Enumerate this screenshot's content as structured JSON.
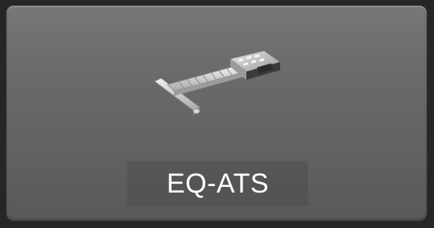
{
  "tile": {
    "label": "EQ-ATS",
    "icon": "equipment-arm-icon"
  },
  "colors": {
    "background": "#262626",
    "tile_face": "#6b6b6b",
    "label_text": "#ffffff"
  }
}
